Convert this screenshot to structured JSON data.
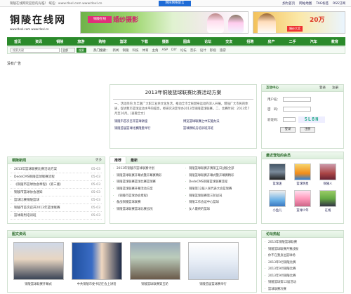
{
  "topbar": {
    "notice": "铜陵在线网欢迎您的光临！ 域名：www.tlexl.com www.tlexl.cn",
    "hotlink": "网民网络留言",
    "links": [
      "加为首页",
      "网站地图",
      "TAG标签",
      "RSS订阅"
    ]
  },
  "logo": {
    "name": "铜陵在线网",
    "url": "www.tlexl.com  www.tlexl.cn"
  },
  "banner1": {
    "tag": "铜陵在线",
    "title": "婚纱摄影"
  },
  "banner2": {
    "title": "20万",
    "sub": "婚纱大奖"
  },
  "nav": [
    "首页",
    "资讯",
    "铜陵",
    "旅游",
    "购物",
    "篮球",
    "下载",
    "摄影",
    "图库",
    "论坛",
    "交友",
    "招聘",
    "房产",
    "二手",
    "汽车",
    "教育"
  ],
  "search": {
    "placeholder": "搜索关键",
    "button": "搜索",
    "scope": "全部",
    "hot_label": "热门搜索：",
    "hot": [
      "新闻",
      "铜陵",
      "科技",
      "体育",
      "主角",
      "ASP",
      "DIY",
      "论坛",
      "音乐",
      "设计",
      "影视",
      "旅游"
    ]
  },
  "ad_strip": "没有广告",
  "feature": {
    "title": "2013年铜陵篮球联赛比赛活动方案",
    "body": "一、活动目的 为丰富广大职工业余文化生活，推动全市全民健身运动的深入开展，增强广大市民的体质，促进我市篮球运动水平的提高，经研究决定举办2013年铜陵篮球联赛。二、比赛时间：2013年7月至10月。[查看全文]",
    "links": [
      "铜陵市首次召开篮球讲座",
      "博览篮球联赛之中实施办法",
      "铜陵首届篮球比赛隆重举行",
      "篮球教练员培训班开班"
    ]
  },
  "left_panel": {
    "title": "铜陵新闻",
    "more": "更多",
    "items": [
      {
        "text": "2013年篮球联赛比赛活动方案",
        "date": "05-03"
      },
      {
        "text": "DedeCMS铜陵篮球联赛流程",
        "date": "05-03"
      },
      {
        "text": "《铜陵市篮球协会章程》（第三版）",
        "date": "05-03"
      },
      {
        "text": "铜陵市篮球协会通知",
        "date": "05-03"
      },
      {
        "text": "篮球比赛铜陵篮球",
        "date": "05-03"
      },
      {
        "text": "铜陵市首次召开2013年篮球联赛",
        "date": "05-03"
      },
      {
        "text": "篮球裁判培训班",
        "date": "05-03"
      },
      {
        "text": "铜陵篮球联赛",
        "date": "05-03"
      }
    ]
  },
  "mid_tabs": [
    "推荐",
    "最新"
  ],
  "mid_list": [
    "2013年铜陵市篮球联赛计划",
    "铜陵篮球联赛开赛第五日战报全部",
    "铜陵篮球联赛开幕式暨开幕赛精彩",
    "铜陵篮球联赛开幕式暨开幕赛精彩",
    "铜陵篮球联赛篮球比赛篮球赛",
    "DedeCMS铜陵篮球联赛流程",
    "铜陵篮球联赛开幕活动方案",
    "铜陵第12届人民代表大会篮球赛",
    "《铜陵市篮球协会章程》",
    "铜陵篮球联赛第三轮战况",
    "备战铜陵篮球联赛",
    "铜陵工作会议中心篮球",
    "铜陵篮球联赛篮球比赛战况",
    "女人最终的篮球"
  ],
  "login": {
    "tabs": [
      "互动中心",
      "登录",
      "注册"
    ],
    "user_label": "用户名：",
    "pass_label": "密　码：",
    "code_label": "验证码：",
    "captcha": "SL8N",
    "login_btn": "登录",
    "reg_btn": "注册"
  },
  "members": {
    "title": "最近登陆的会员",
    "names": [
      "篮球迷",
      "篮球明星",
      "铜陵人",
      "小鱼儿",
      "篮球少年",
      "在线"
    ]
  },
  "photos": {
    "title": "图文资讯",
    "captions": [
      "铜陵篮球联赛开幕式",
      "中共铜陵市委书记在会上讲话",
      "铜陵篮球联赛第五轮",
      "铜陵首届篮球赛举行"
    ]
  },
  "hot": {
    "title": "论坛热帖",
    "items": [
      "2013年铜陵篮球联赛",
      "铜陵篮球联赛开赛战报",
      "你不在我身边篮球场",
      "2013年9月铜陵比赛",
      "2013年9月铜陵比赛",
      "2013年9月铜陵比赛",
      "铜陵篮球第12届活动",
      "篮球联赛决赛",
      "铜陵篮球联赛冠军"
    ]
  },
  "colors": {
    "nav": "#2b8a2b",
    "hotlink": "#1e6bd6",
    "accent": "#d0246b"
  }
}
